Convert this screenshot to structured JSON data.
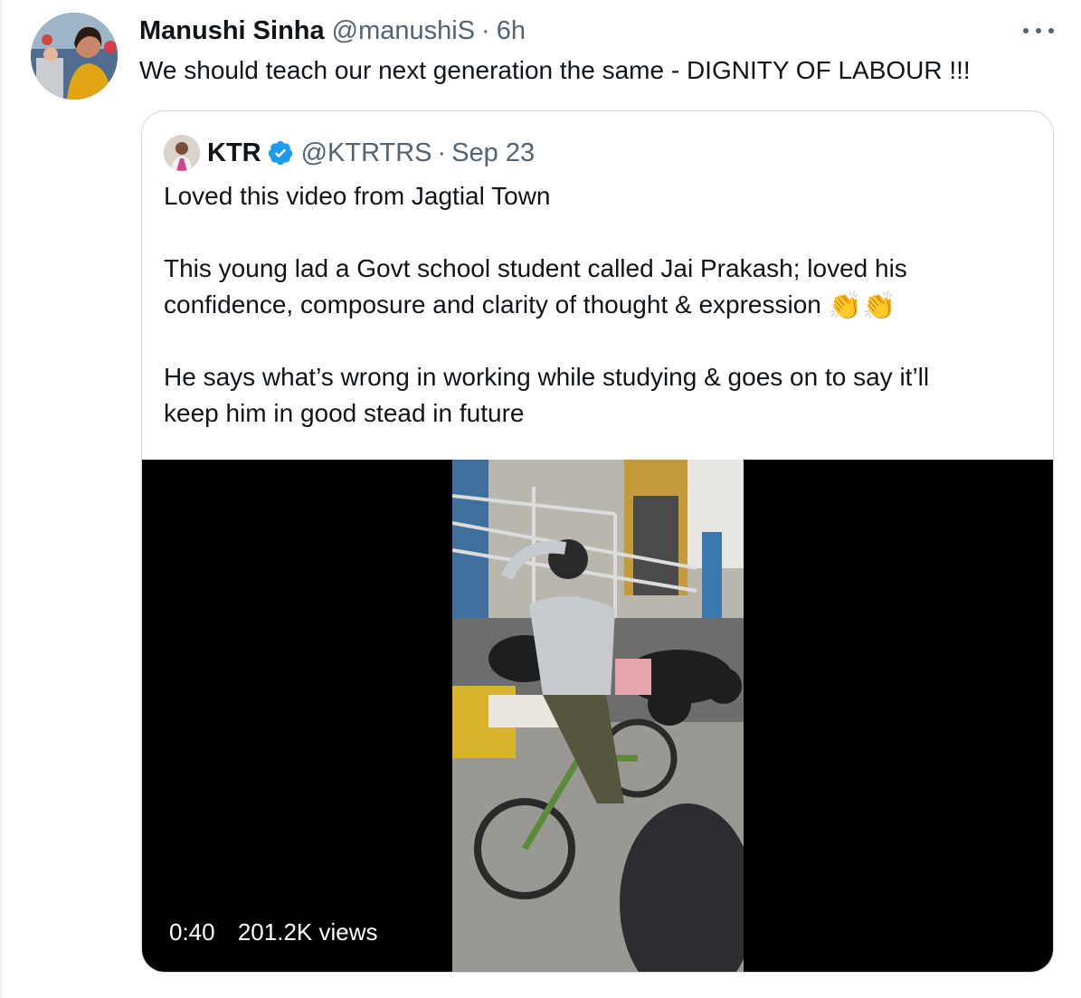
{
  "tweet": {
    "author_name": "Manushi Sinha",
    "author_handle": "@manushiS",
    "separator": "·",
    "time": "6h",
    "text": "We should teach our next generation the same - DIGNITY OF LABOUR !!!",
    "more_icon": "more-dots-icon"
  },
  "quoted": {
    "author_name": "KTR",
    "verified_icon": "verified-badge-icon",
    "verified_color": "#1d9bf0",
    "author_handle": "@KTRTRS",
    "separator": "·",
    "date": "Sep 23",
    "lines": {
      "l1": "Loved this video from Jagtial Town",
      "l2": "This young lad a Govt school student called Jai Prakash; loved his",
      "l3": "confidence, composure and clarity of thought & expression",
      "clap": "👏👏",
      "l4": "He says what’s wrong in working while studying & goes on to say it’ll",
      "l5": "keep him in good stead in future"
    },
    "video": {
      "duration": "0:40",
      "views": "201.2K views"
    }
  },
  "colors": {
    "text": "#0f1419",
    "secondary": "#536471",
    "border": "#cfd9de"
  }
}
